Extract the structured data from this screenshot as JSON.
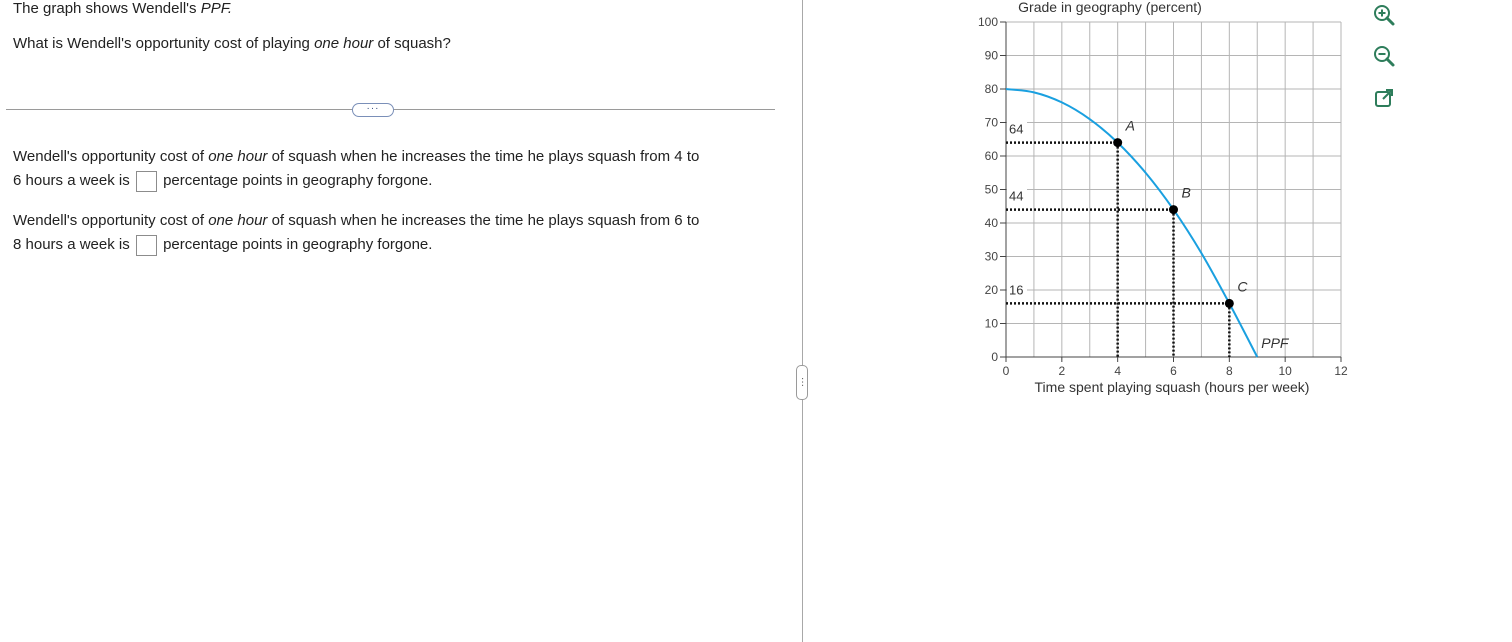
{
  "question": {
    "intro_plain": "The graph shows Wendell's ",
    "intro_em": "PPF.",
    "ask_pre": "What is Wendell's opportunity cost of playing ",
    "ask_em": "one hour",
    "ask_post": " of squash?"
  },
  "more_button": "···",
  "answers": [
    {
      "pre": "Wendell's opportunity cost of ",
      "em": "one hour",
      "mid": " of squash when he increases the time he plays squash from 4 to",
      "line2_pre": "6 hours a week is",
      "line2_post": "percentage points in geography forgone.",
      "value": ""
    },
    {
      "pre": "Wendell's opportunity cost of ",
      "em": "one hour",
      "mid": " of squash when he increases the time he plays squash from 6 to",
      "line2_pre": "8 hours a week is",
      "line2_post": "percentage points in geography forgone.",
      "value": ""
    }
  ],
  "pane_handle": "···",
  "tools": [
    "zoom-in-icon",
    "zoom-out-icon",
    "popout-icon"
  ],
  "chart_data": {
    "type": "line",
    "ylabel": "Grade in geography (percent)",
    "xlabel": "Time spent playing squash (hours per week)",
    "xlim": [
      0,
      12
    ],
    "ylim": [
      0,
      100
    ],
    "x_ticks": [
      0,
      2,
      4,
      6,
      8,
      10,
      12
    ],
    "y_ticks": [
      0,
      10,
      20,
      30,
      40,
      50,
      60,
      70,
      80,
      90,
      100
    ],
    "grid": true,
    "curve_label": "PPF",
    "curve": [
      [
        0,
        80
      ],
      [
        1,
        79
      ],
      [
        2,
        76
      ],
      [
        3,
        71
      ],
      [
        4,
        64
      ],
      [
        5,
        55
      ],
      [
        6,
        44
      ],
      [
        7,
        31
      ],
      [
        8,
        16
      ],
      [
        9,
        0
      ]
    ],
    "points": [
      {
        "label": "A",
        "x": 4,
        "y": 64
      },
      {
        "label": "B",
        "x": 6,
        "y": 44
      },
      {
        "label": "C",
        "x": 8,
        "y": 16
      }
    ],
    "y_value_labels": [
      "64",
      "44",
      "16"
    ],
    "line_color": "#1aa0e0",
    "point_color": "#000000"
  }
}
